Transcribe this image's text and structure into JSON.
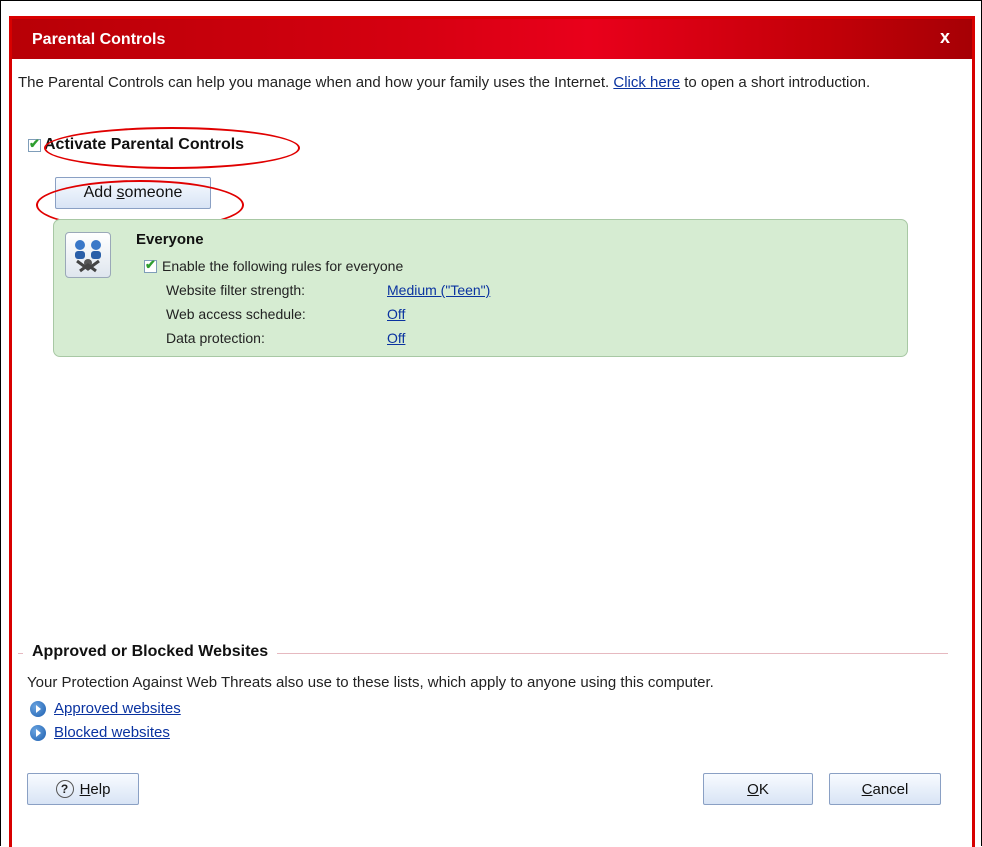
{
  "dialog": {
    "title": "Parental Controls",
    "close_label": "x"
  },
  "intro": {
    "text": "The Parental Controls can help you manage when and how your family uses the Internet.",
    "link": "Click here",
    "text_after": "to open a short introduction."
  },
  "activate": {
    "label": "Activate Parental Controls",
    "checked": true
  },
  "add_someone": {
    "label_pre": "Add ",
    "label_accel": "s",
    "label_post": "omeone"
  },
  "everyone_panel": {
    "title": "Everyone",
    "enable_label": "Enable the following rules for everyone",
    "enable_checked": true,
    "rules": [
      {
        "label": "Website filter strength:",
        "value": "Medium (\"Teen\")"
      },
      {
        "label": "Web access schedule:",
        "value": "Off"
      },
      {
        "label": "Data protection:",
        "value": "Off"
      }
    ]
  },
  "websites_section": {
    "title": "Approved or Blocked Websites",
    "description": "Your Protection Against Web Threats also use to these lists, which apply to anyone using this computer.",
    "approved_link": "Approved websites",
    "blocked_link": "Blocked websites"
  },
  "buttons": {
    "help_accel": "H",
    "help_rest": "elp",
    "ok_accel": "O",
    "ok_rest": "K",
    "cancel_accel": "C",
    "cancel_rest": "ancel"
  },
  "icons": {
    "close": "close-icon",
    "users": "users-group-icon",
    "arrow": "arrow-circle-icon",
    "help": "help-icon"
  },
  "colors": {
    "title_bar": "#d40010",
    "panel_bg": "#d6ecd2",
    "link": "#0a33a0",
    "annotation": "#e00000"
  }
}
